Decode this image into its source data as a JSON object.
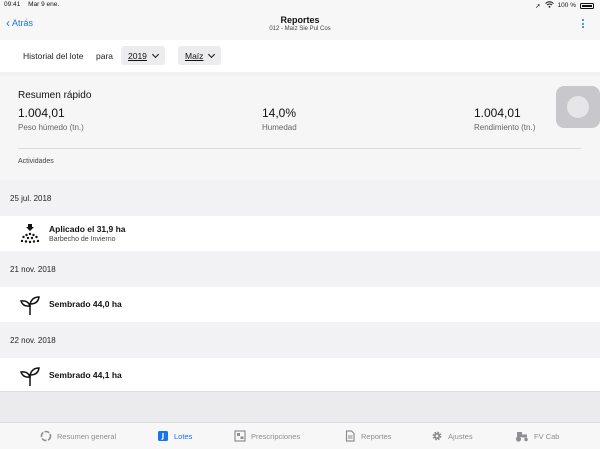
{
  "status": {
    "time": "09:41",
    "date": "Mar 9 ene.",
    "battery": "100 %"
  },
  "nav": {
    "back_label": "Atrás",
    "title": "Reportes",
    "subtitle": "012 - Maíz Sie Pul Cos"
  },
  "filter": {
    "label": "Historial del lote",
    "para": "para",
    "year": "2019",
    "crop": "Maíz"
  },
  "summary": {
    "title": "Resumen rápido",
    "metrics": [
      {
        "value": "1.004,01",
        "label": "Peso húmedo (tn.)"
      },
      {
        "value": "14,0%",
        "label": "Humedad"
      },
      {
        "value": "1.004,01",
        "label": "Rendimiento (tn.)"
      }
    ],
    "activities_label": "Actividades"
  },
  "activities": [
    {
      "date": "25 jul. 2018",
      "title": "Aplicado el 31,9 ha",
      "subtitle": "Barbecho de Invierno",
      "icon": "sprayer-icon"
    },
    {
      "date": "21 nov. 2018",
      "title": "Sembrado 44,0 ha",
      "subtitle": "",
      "icon": "seedling-icon"
    },
    {
      "date": "22 nov. 2018",
      "title": "Sembrado 44,1 ha",
      "subtitle": "",
      "icon": "seedling-icon"
    }
  ],
  "tabs": [
    {
      "label": "Resumen general",
      "icon": "overview-icon",
      "active": false
    },
    {
      "label": "Lotes",
      "icon": "fields-icon",
      "active": true
    },
    {
      "label": "Prescripciones",
      "icon": "prescriptions-icon",
      "active": false
    },
    {
      "label": "Reportes",
      "icon": "reports-icon",
      "active": false
    },
    {
      "label": "Ajustes",
      "icon": "gear-icon",
      "active": false
    },
    {
      "label": "FV Cab",
      "icon": "tractor-icon",
      "active": false
    }
  ],
  "colors": {
    "accent": "#1a73e8",
    "inactive": "#8e8e93"
  }
}
